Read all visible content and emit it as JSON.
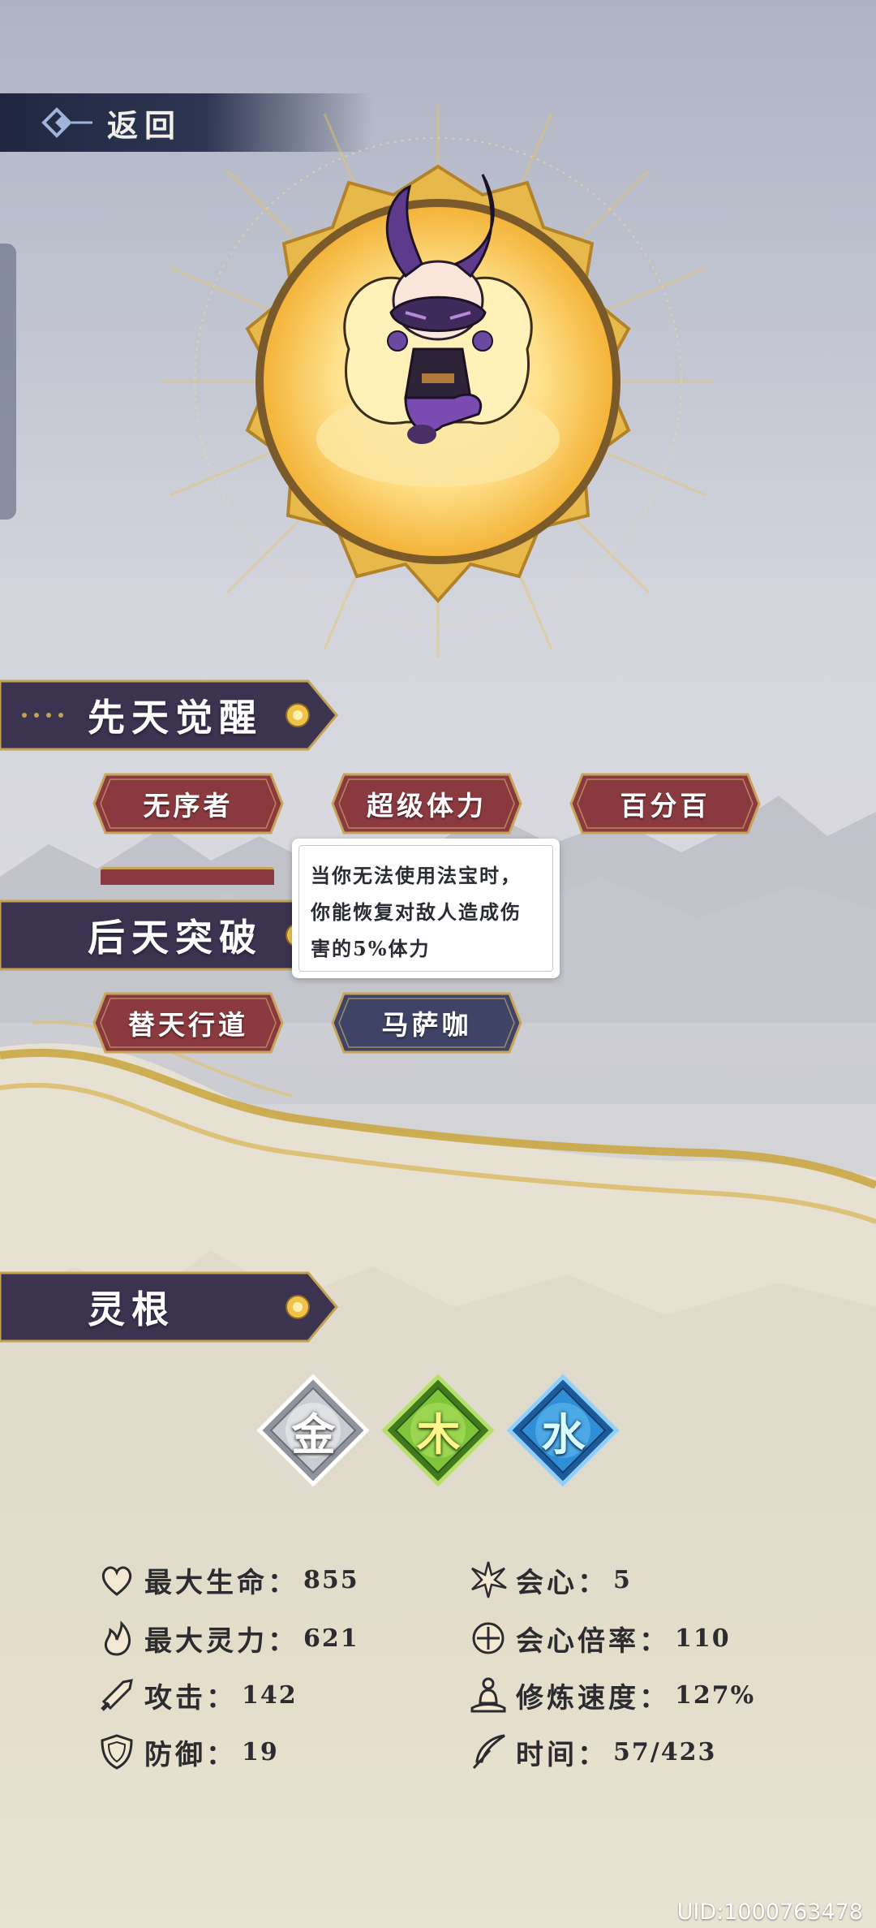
{
  "header": {
    "back_label": "返回"
  },
  "awakening": {
    "title": "先天觉醒",
    "talents": [
      {
        "label": "无序者",
        "style": "red"
      },
      {
        "label": "超级体力",
        "style": "red"
      },
      {
        "label": "百分百",
        "style": "red"
      }
    ]
  },
  "tooltip": {
    "lines": [
      "当你无法使用法宝时，",
      "你能恢复对敌人造成伤",
      "害的5%体力"
    ]
  },
  "breakthrough": {
    "title": "后天突破",
    "talents": [
      {
        "label": "替天行道",
        "style": "red"
      },
      {
        "label": "马萨咖",
        "style": "navy"
      }
    ]
  },
  "spirit_root": {
    "title": "灵根",
    "elements": [
      {
        "label": "金",
        "color": "#c9ccd3"
      },
      {
        "label": "木",
        "color": "#7fc43a"
      },
      {
        "label": "水",
        "color": "#2f8fd6"
      }
    ]
  },
  "stats": {
    "left": [
      {
        "icon": "heart-icon",
        "label": "最大生命：",
        "value": "855"
      },
      {
        "icon": "flame-icon",
        "label": "最大灵力：",
        "value": "621"
      },
      {
        "icon": "sword-icon",
        "label": "攻击：",
        "value": "142"
      },
      {
        "icon": "shield-icon",
        "label": "防御：",
        "value": "19"
      }
    ],
    "right": [
      {
        "icon": "burst-icon",
        "label": "会心：",
        "value": "5"
      },
      {
        "icon": "crosshair-icon",
        "label": "会心倍率：",
        "value": "110"
      },
      {
        "icon": "meditation-icon",
        "label": "修炼速度：",
        "value": "127%"
      },
      {
        "icon": "feather-icon",
        "label": "时间：",
        "value": "57/423"
      }
    ]
  },
  "footer": {
    "uid": "UID:1000763478"
  },
  "colors": {
    "banner": "#3b3350",
    "talent_red": "#8a3a3f",
    "talent_navy": "#3f4466",
    "gold": "#d8b04a"
  }
}
